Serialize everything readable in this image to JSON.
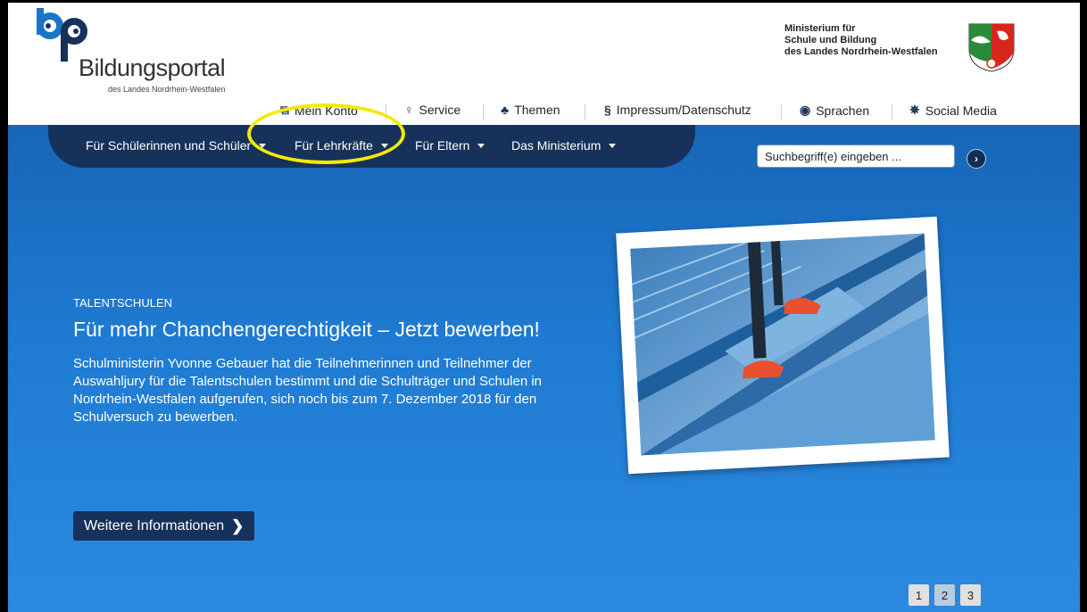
{
  "header": {
    "logo_letters": "bp",
    "logo_title": "Bildungsportal",
    "logo_subtitle": "des Landes Nordrhein-Westfalen",
    "ministry_lines": [
      "Ministerium für",
      "Schule und Bildung",
      "des Landes Nordrhein-Westfalen"
    ]
  },
  "topnav": [
    {
      "label": "Mein Konto",
      "icon": "account-icon"
    },
    {
      "label": "Service",
      "icon": "lightbulb-icon"
    },
    {
      "label": "Themen",
      "icon": "sitemap-icon"
    },
    {
      "label": "Impressum/Datenschutz",
      "icon": "paragraph-icon"
    },
    {
      "label": "Sprachen",
      "icon": "globe-icon"
    },
    {
      "label": "Social Media",
      "icon": "network-icon"
    }
  ],
  "mainnav": [
    {
      "label": "Für Schülerinnen und Schüler"
    },
    {
      "label": "Für Lehrkräfte"
    },
    {
      "label": "Für Eltern"
    },
    {
      "label": "Das Ministerium"
    }
  ],
  "search": {
    "placeholder": "Suchbegriff(e) eingeben ..."
  },
  "hero": {
    "label": "TALENTSCHULEN",
    "title": "Für mehr Chanchengerechtigkeit – Jetzt bewerben!",
    "text": "Schulministerin Yvonne Gebauer hat die Teilnehmerinnen und Teilnehmer der Auswahljury für die Talentschulen bestimmt und die Schulträger und Schulen in Nordrhein-Westfalen aufgerufen, sich noch bis zum 7. Dezember 2018 für den Schulversuch zu bewerben.",
    "button": "Weitere Informationen"
  },
  "pager": [
    "1",
    "2",
    "3"
  ],
  "colors": {
    "accent": "#17325a",
    "hero": "#1f7bd2",
    "highlight": "#f4ea00"
  }
}
